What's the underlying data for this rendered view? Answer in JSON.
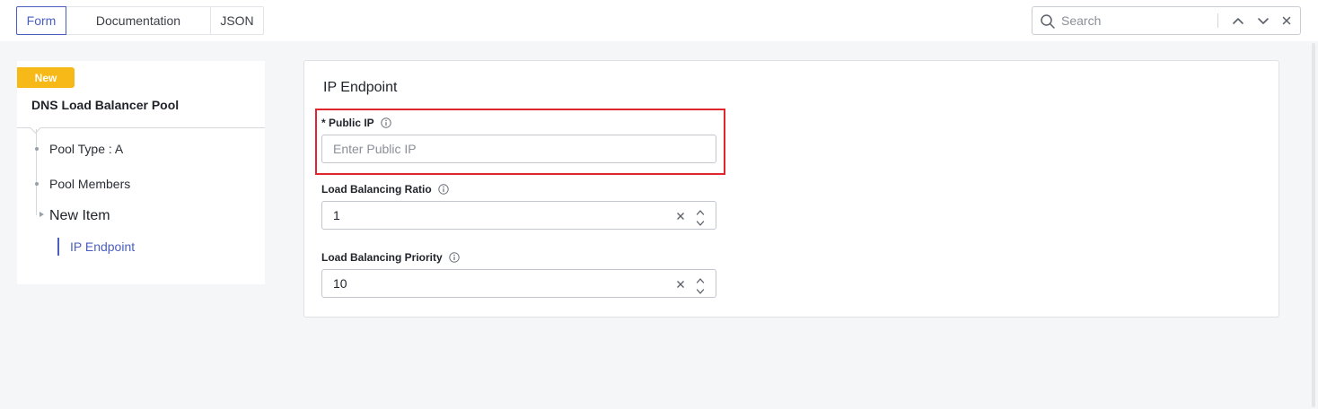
{
  "tabs": [
    {
      "label": "Form",
      "active": true
    },
    {
      "label": "Documentation",
      "active": false
    },
    {
      "label": "JSON",
      "active": false
    }
  ],
  "search": {
    "placeholder": "Search",
    "icon": "search-icon",
    "controls": [
      "chevron-up-icon",
      "chevron-down-icon",
      "close-icon"
    ]
  },
  "sidebar": {
    "badge": "New",
    "title": "DNS Load Balancer Pool",
    "items": [
      {
        "label": "Pool Type : A"
      },
      {
        "label": "Pool Members"
      },
      {
        "label": "New Item"
      }
    ],
    "selected_child": "IP Endpoint"
  },
  "panel": {
    "title": "IP Endpoint",
    "fields": [
      {
        "label": "* Public IP",
        "value": "",
        "placeholder": "Enter Public IP",
        "highlighted": true
      },
      {
        "label": "Load Balancing Ratio",
        "value": "1"
      },
      {
        "label": "Load Balancing Priority",
        "value": "10"
      }
    ]
  },
  "colors": {
    "accent": "#4a5fc1",
    "badge": "#f7b918",
    "highlight": "#e0262c",
    "background": "#f5f6f8"
  }
}
